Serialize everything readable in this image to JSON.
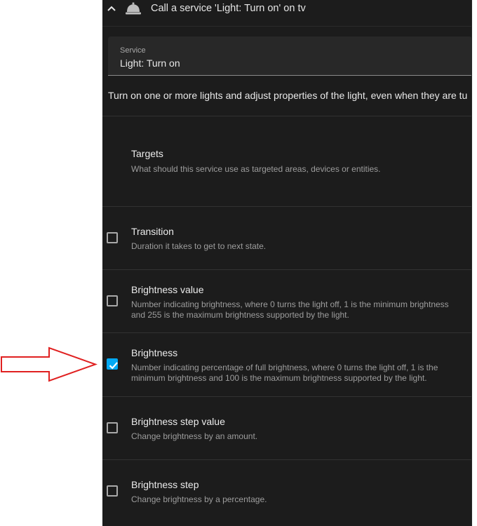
{
  "header": {
    "title": "Call a service 'Light: Turn on' on tv",
    "icons": {
      "collapse": "chevron-up-icon",
      "service": "bell-icon"
    }
  },
  "service_field": {
    "label": "Service",
    "value": "Light: Turn on"
  },
  "description": "Turn on one or more lights and adjust properties of the light, even when they are tu",
  "fields": [
    {
      "title": "Targets",
      "description": "What should this service use as targeted areas, devices or entities.",
      "has_checkbox": false
    },
    {
      "title": "Transition",
      "description": "Duration it takes to get to next state.",
      "checked": false
    },
    {
      "title": "Brightness value",
      "description": "Number indicating brightness, where 0 turns the light off, 1 is the minimum brightness and 255 is the maximum brightness supported by the light.",
      "checked": false
    },
    {
      "title": "Brightness",
      "description": "Number indicating percentage of full brightness, where 0 turns the light off, 1 is the minimum brightness and 100 is the maximum brightness supported by the light.",
      "checked": true
    },
    {
      "title": "Brightness step value",
      "description": "Change brightness by an amount.",
      "checked": false
    },
    {
      "title": "Brightness step",
      "description": "Change brightness by a percentage.",
      "checked": false
    }
  ],
  "colors": {
    "checkbox_checked": "#03a9f4",
    "annotation_arrow": "#e02020",
    "panel_bg": "#1c1c1c"
  }
}
